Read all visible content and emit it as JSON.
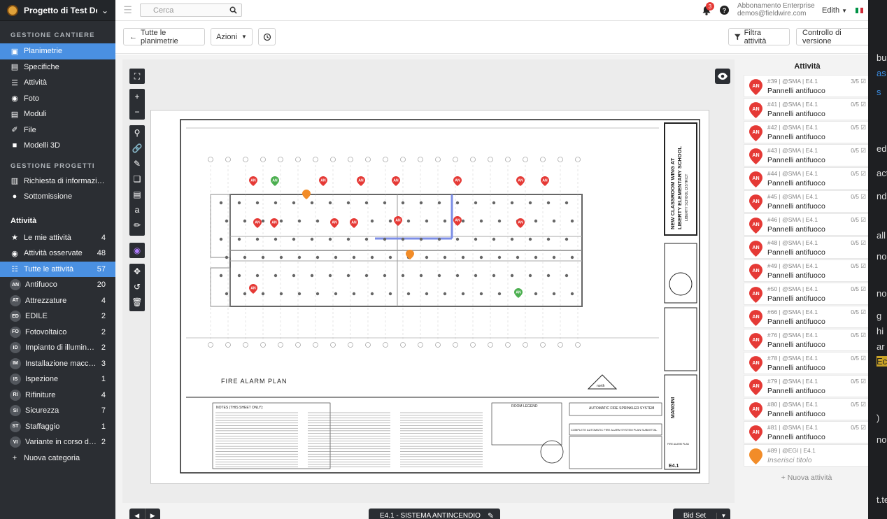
{
  "project": {
    "name": "Progetto di Test De..."
  },
  "sidebar": {
    "section1": "GESTIONE CANTIERE",
    "cantiere_items": [
      {
        "icon": "blueprint-icon",
        "label": "Planimetrie",
        "active": true
      },
      {
        "icon": "book-icon",
        "label": "Specifiche"
      },
      {
        "icon": "list-icon",
        "label": "Attività"
      },
      {
        "icon": "camera-icon",
        "label": "Foto"
      },
      {
        "icon": "form-icon",
        "label": "Moduli"
      },
      {
        "icon": "paperclip-icon",
        "label": "File"
      },
      {
        "icon": "cube-icon",
        "label": "Modelli 3D"
      }
    ],
    "section2": "GESTIONE PROGETTI",
    "progetti_items": [
      {
        "icon": "document-icon",
        "label": "Richiesta di informazioni"
      },
      {
        "icon": "person-icon",
        "label": "Sottomissione"
      }
    ],
    "section3": "Attività",
    "activity_items": [
      {
        "icon": "star-icon",
        "label": "Le mie attività",
        "count": "4"
      },
      {
        "icon": "eye-icon",
        "label": "Attività osservate",
        "count": "48"
      },
      {
        "icon": "grid-icon",
        "label": "Tutte le attività",
        "count": "57",
        "active": true
      },
      {
        "abbr": "AN",
        "label": "Antifuoco",
        "count": "20"
      },
      {
        "abbr": "AT",
        "label": "Attrezzature",
        "count": "4"
      },
      {
        "abbr": "ED",
        "label": "EDILE",
        "count": "2"
      },
      {
        "abbr": "FO",
        "label": "Fotovoltaico",
        "count": "2"
      },
      {
        "abbr": "ID",
        "label": "Impianto di illuminazi...",
        "count": "2"
      },
      {
        "abbr": "IM",
        "label": "Installazione macchin...",
        "count": "3"
      },
      {
        "abbr": "IS",
        "label": "Ispezione",
        "count": "1"
      },
      {
        "abbr": "RI",
        "label": "Rifiniture",
        "count": "4"
      },
      {
        "abbr": "SI",
        "label": "Sicurezza",
        "count": "7"
      },
      {
        "abbr": "ST",
        "label": "Staffaggio",
        "count": "1"
      },
      {
        "abbr": "VI",
        "label": "Variante in corso d'op...",
        "count": "2"
      },
      {
        "icon": "plus-icon",
        "label": "Nuova categoria"
      }
    ]
  },
  "topbar": {
    "search_placeholder": "Cerca",
    "notifications_count": "3",
    "help": "?",
    "account_plan": "Abbonamento Enterprise",
    "account_email": "demos@fieldwire.com",
    "user_name": "Edith",
    "flag_colors": [
      "#009246",
      "#ffffff",
      "#ce2b37"
    ]
  },
  "toolbar": {
    "back_label": "Tutte le planimetrie",
    "actions_label": "Azioni",
    "filter_label": "Filtra attività",
    "version_label": "Controllo di versione"
  },
  "drawing": {
    "plan_title": "FIRE ALARM PLAN",
    "school_title_1": "NEW CLASSROOM WING AT",
    "school_title_2": "LIBERTY ELEMENTARY SCHOOL",
    "district": "LIBERTY SCHOOL DISTRICT",
    "north_label": "north",
    "architect": "MANGINI",
    "sheet_no": "E4.1",
    "notes_title": "NOTES (THIS SHEET ONLY):",
    "legend_title": "ROOM LEGEND",
    "sprinkler_title": "AUTOMATIC FIRE SPRINKLER SYSTEM",
    "complete_title": "COMPLETE AUTOMATIC FIRE ALARM SYSTEM PLAN SUBMITTAL",
    "sheet_caption": "FIRE ALARM PLAN"
  },
  "footer": {
    "sheet_name": "E4.1 - SISTEMA ANTINCENDIO",
    "set_name": "Bid Set"
  },
  "activities": {
    "title": "Attività",
    "items": [
      {
        "meta": "#39 | @SMA | E4.1",
        "progress": "3/5",
        "name": "Pannelli antifuoco"
      },
      {
        "meta": "#41 | @SMA | E4.1",
        "progress": "0/5",
        "name": "Pannelli antifuoco"
      },
      {
        "meta": "#42 | @SMA | E4.1",
        "progress": "0/5",
        "name": "Pannelli antifuoco"
      },
      {
        "meta": "#43 | @SMA | E4.1",
        "progress": "0/5",
        "name": "Pannelli antifuoco"
      },
      {
        "meta": "#44 | @SMA | E4.1",
        "progress": "0/5",
        "name": "Pannelli antifuoco"
      },
      {
        "meta": "#45 | @SMA | E4.1",
        "progress": "0/5",
        "name": "Pannelli antifuoco"
      },
      {
        "meta": "#46 | @SMA | E4.1",
        "progress": "0/5",
        "name": "Pannelli antifuoco"
      },
      {
        "meta": "#48 | @SMA | E4.1",
        "progress": "0/5",
        "name": "Pannelli antifuoco"
      },
      {
        "meta": "#49 | @SMA | E4.1",
        "progress": "0/5",
        "name": "Pannelli antifuoco"
      },
      {
        "meta": "#50 | @SMA | E4.1",
        "progress": "0/5",
        "name": "Pannelli antifuoco"
      },
      {
        "meta": "#66 | @SMA | E4.1",
        "progress": "0/5",
        "name": "Pannelli antifuoco"
      },
      {
        "meta": "#76 | @SMA | E4.1",
        "progress": "0/5",
        "name": "Pannelli antifuoco"
      },
      {
        "meta": "#78 | @SMA | E4.1",
        "progress": "0/5",
        "name": "Pannelli antifuoco"
      },
      {
        "meta": "#79 | @SMA | E4.1",
        "progress": "0/5",
        "name": "Pannelli antifuoco"
      },
      {
        "meta": "#80 | @SMA | E4.1",
        "progress": "0/5",
        "name": "Pannelli antifuoco"
      },
      {
        "meta": "#81 | @SMA | E4.1",
        "progress": "0/5",
        "name": "Pannelli antifuoco"
      },
      {
        "meta": "#89 | @EGI | E4.1",
        "progress": "",
        "name": "Inserisci titolo",
        "placeholder": true,
        "pin": "orange"
      }
    ],
    "new_label": "+ Nuova attività",
    "pin_abbr": "AN",
    "pin_color": "#e53935",
    "orange_color": "#f28c28"
  },
  "strip_texts": [
    "bu",
    "as",
    "s",
    "ed",
    "act",
    "nd",
    "all",
    "no",
    "no",
    "g",
    "hi",
    "ar",
    "Ec",
    ")",
    "no",
    "t.te"
  ]
}
